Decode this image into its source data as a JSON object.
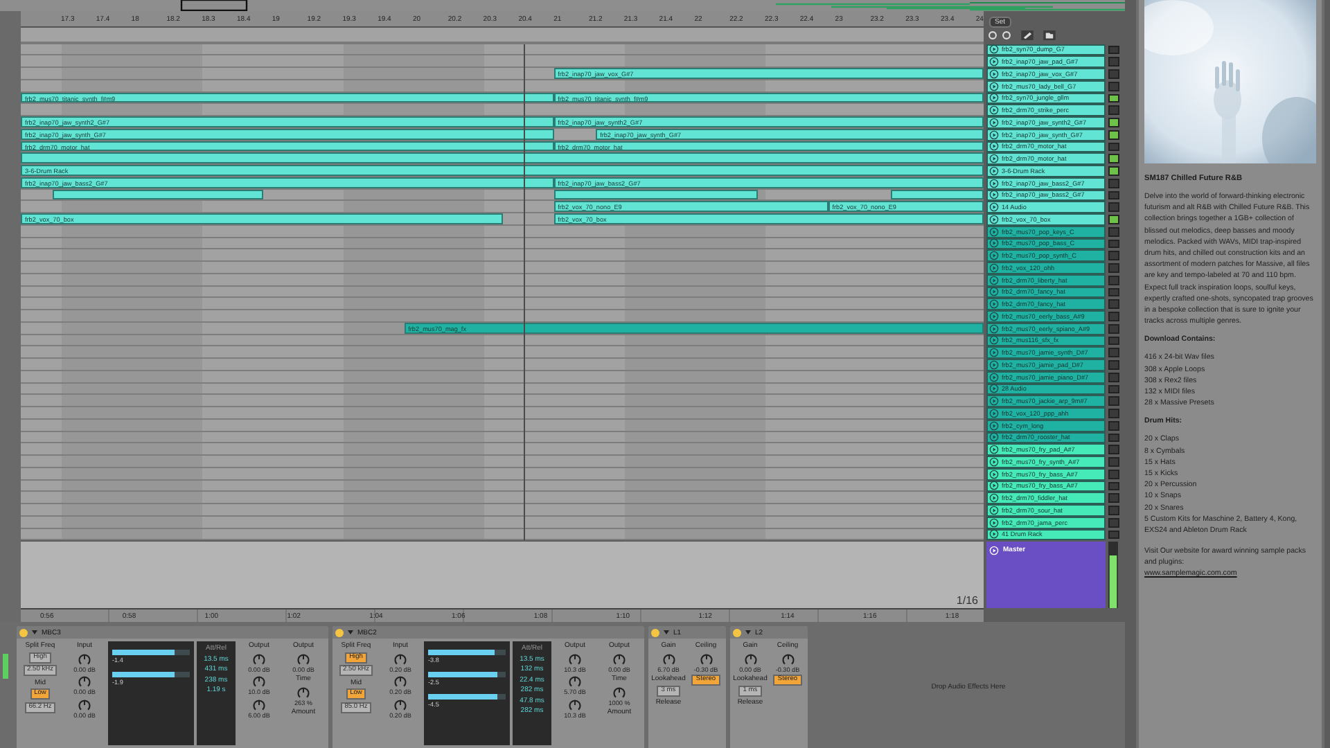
{
  "ruler": {
    "ticks": [
      "17.3",
      "17.4",
      "18",
      "18.2",
      "18.3",
      "18.4",
      "19",
      "19.2",
      "19.3",
      "19.4",
      "20",
      "20.2",
      "20.3",
      "20.4",
      "21",
      "21.2",
      "21.3",
      "21.4",
      "22",
      "22.2",
      "22.3",
      "22.4",
      "23",
      "23.2",
      "23.3",
      "23.4",
      "24"
    ]
  },
  "set_button": "Set",
  "tracks": [
    {
      "name": "frb2_syn70_dump_G7",
      "color": "#62e4d4",
      "active": false
    },
    {
      "name": "frb2_inap70_jaw_pad_G#7",
      "color": "#62e4d4",
      "active": false
    },
    {
      "name": "frb2_inap70_jaw_vox_G#7",
      "color": "#62e4d4",
      "active": false,
      "clips": [
        {
          "kind": "tail",
          "label": "frb2_inap70_jaw_vox_G#7"
        }
      ]
    },
    {
      "name": "frb2_mus70_lady_bell_G7",
      "color": "#62e4d4",
      "active": false
    },
    {
      "name": "frb2_syn70_jungle_gllm",
      "color": "#62e4d4",
      "active": true,
      "clips": [
        {
          "kind": "lead",
          "label": "frb2_mus70_titanic_synth_f#m9"
        },
        {
          "kind": "tail",
          "label": "frb2_mus70_titanic_synth_f#m9"
        }
      ]
    },
    {
      "name": "frb2_drm70_strike_perc",
      "color": "#62e4d4",
      "active": false
    },
    {
      "name": "frb2_inap70_jaw_synth2_G#7",
      "color": "#62e4d4",
      "active": true,
      "clips": [
        {
          "kind": "lead",
          "label": "frb2_inap70_jaw_synth2_G#7"
        },
        {
          "kind": "tail",
          "label": "frb2_inap70_jaw_synth2_G#7"
        }
      ]
    },
    {
      "name": "frb2_inap70_jaw_synth_G#7",
      "color": "#62e4d4",
      "active": true,
      "clips": [
        {
          "kind": "lead",
          "label": "frb2_inap70_jaw_synth_G#7"
        },
        {
          "kind": "tail_late",
          "label": "frb2_inap70_jaw_synth_G#7"
        }
      ]
    },
    {
      "name": "frb2_drm70_motor_hat",
      "color": "#62e4d4",
      "active": false,
      "clips": [
        {
          "kind": "lead",
          "label": "frb2_drm70_motor_hat"
        },
        {
          "kind": "tail",
          "label": "frb2_drm70_motor_hat"
        }
      ]
    },
    {
      "name": "frb2_drm70_motor_hat",
      "color": "#62e4d4",
      "active": true,
      "clips": [
        {
          "kind": "full"
        }
      ]
    },
    {
      "name": "3-6-Drum Rack",
      "color": "#62e4d4",
      "active": true,
      "clips": [
        {
          "kind": "full",
          "label": "3-6-Drum Rack"
        }
      ]
    },
    {
      "name": "frb2_inap70_jaw_bass2_G#7",
      "color": "#62e4d4",
      "active": false,
      "clips": [
        {
          "kind": "lead",
          "label": "frb2_inap70_jaw_bass2_G#7"
        },
        {
          "kind": "tail",
          "label": "frb2_inap70_jaw_bass2_G#7"
        }
      ]
    },
    {
      "name": "frb2_inap70_jaw_bass2_G#7",
      "color": "#62e4d4",
      "active": false,
      "clips": [
        {
          "kind": "fragment_early"
        },
        {
          "kind": "fragment_mid"
        },
        {
          "kind": "fragment_late"
        }
      ]
    },
    {
      "name": "14 Audio",
      "color": "#62e4d4",
      "active": false,
      "clips": [
        {
          "kind": "phrase",
          "label": "frb2_vox_70_nono_E9"
        },
        {
          "kind": "phrase_end",
          "label": "frb2_vox_70_nono_E9"
        }
      ]
    },
    {
      "name": "frb2_vox_70_box",
      "color": "#62e4d4",
      "active": true,
      "clips": [
        {
          "kind": "lead_short",
          "label": "frb2_vox_70_box"
        },
        {
          "kind": "tail",
          "label": "frb2_vox_70_box"
        }
      ]
    },
    {
      "name": "frb2_mus70_pop_keys_C",
      "color": "#1fb2a2",
      "active": false
    },
    {
      "name": "frb2_mus70_pop_bass_C",
      "color": "#1fb2a2",
      "active": false
    },
    {
      "name": "frb2_mus70_pop_synth_C",
      "color": "#1fb2a2",
      "active": false
    },
    {
      "name": "frb2_vox_120_ohh",
      "color": "#1fb2a2",
      "active": false
    },
    {
      "name": "frb2_drm70_liberty_hat",
      "color": "#1fb2a2",
      "active": false
    },
    {
      "name": "frb2_drm70_fancy_hat",
      "color": "#1fb2a2",
      "active": false
    },
    {
      "name": "frb2_drm70_fancy_hat",
      "color": "#1fb2a2",
      "active": false
    },
    {
      "name": "frb2_mus70_eerly_bass_A#9",
      "color": "#1fb2a2",
      "active": false
    },
    {
      "name": "frb2_mus70_eerly_spiano_A#9",
      "color": "#1fb2a2",
      "active": false,
      "clips": [
        {
          "kind": "late_entry",
          "label": "frb2_mus70_mag_fx"
        }
      ]
    },
    {
      "name": "frb2_mus116_sfx_fx",
      "color": "#1fb2a2",
      "active": false
    },
    {
      "name": "frb2_mus70_jamie_synth_D#7",
      "color": "#1fb2a2",
      "active": false
    },
    {
      "name": "frb2_mus70_jamie_pad_D#7",
      "color": "#1fb2a2",
      "active": false
    },
    {
      "name": "frb2_mus70_jamie_piano_D#7",
      "color": "#1fb2a2",
      "active": false
    },
    {
      "name": "28 Audio",
      "color": "#1fb2a2",
      "active": false
    },
    {
      "name": "frb2_mus70_jackie_arp_9m#7",
      "color": "#1fb2a2",
      "active": false
    },
    {
      "name": "frb2_vox_120_ppp_ahh",
      "color": "#1fb2a2",
      "active": false
    },
    {
      "name": "frb2_cym_long",
      "color": "#1fb2a2",
      "active": false
    },
    {
      "name": "frb2_drm70_rooster_hat",
      "color": "#1fb2a2",
      "active": false
    },
    {
      "name": "frb2_mus70_fry_pad_A#7",
      "color": "#46eab8",
      "active": false
    },
    {
      "name": "frb2_mus70_fry_synth_A#7",
      "color": "#46eab8",
      "active": false
    },
    {
      "name": "frb2_mus70_fry_bass_A#7",
      "color": "#46eab8",
      "active": false
    },
    {
      "name": "frb2_mus70_fry_bass_A#7",
      "color": "#46eab8",
      "active": false
    },
    {
      "name": "frb2_drm70_fiddler_hat",
      "color": "#46eab8",
      "active": false
    },
    {
      "name": "frb2_drm70_sour_hat",
      "color": "#46eab8",
      "active": false
    },
    {
      "name": "frb2_drm70_jama_perc",
      "color": "#46eab8",
      "active": false
    },
    {
      "name": "41 Drum Rack",
      "color": "#46eab8",
      "active": false
    }
  ],
  "master": {
    "name": "Master",
    "color": "#6a4fc4"
  },
  "grid_label": "1/16",
  "time_ruler": {
    "ticks": [
      "0:56",
      "0:58",
      "1:00",
      "1:02",
      "1:04",
      "1:06",
      "1:08",
      "1:10",
      "1:12",
      "1:14",
      "1:16",
      "1:18"
    ]
  },
  "devices": [
    {
      "name": "MBC3",
      "kind": "multiband",
      "on": true,
      "columns": [
        {
          "kind": "plain",
          "items": [
            {
              "kind": "label",
              "text": "Split Freq"
            },
            {
              "kind": "button",
              "text": "High",
              "on": false
            },
            {
              "kind": "button",
              "text": "2.50 kHz",
              "on": false
            },
            {
              "kind": "label",
              "text": "Mid"
            },
            {
              "kind": "button",
              "text": "Low",
              "on": true
            },
            {
              "kind": "button",
              "text": "66.2 Hz",
              "on": false
            }
          ]
        },
        {
          "kind": "plain",
          "items": [
            {
              "kind": "label",
              "text": "Input"
            },
            {
              "kind": "knob",
              "text": "0.00 dB"
            },
            {
              "kind": "knob",
              "text": "0.00 dB"
            },
            {
              "kind": "knob",
              "text": "0.00 dB"
            }
          ]
        },
        {
          "kind": "display",
          "items": [
            {
              "kind": "meter",
              "text": "-1.4",
              "level": 0.8
            },
            {
              "kind": "meter",
              "text": "-1.9",
              "level": 0.8
            }
          ]
        },
        {
          "kind": "readouts",
          "items": [
            {
              "kind": "label",
              "text": "Att/Rel"
            },
            {
              "kind": "readout",
              "text": "13.5 ms"
            },
            {
              "kind": "readout",
              "text": "431 ms"
            },
            {
              "kind": "readout",
              "text": "238 ms"
            },
            {
              "kind": "readout",
              "text": "1.19 s"
            }
          ]
        },
        {
          "kind": "plain",
          "items": [
            {
              "kind": "label",
              "text": "Output"
            },
            {
              "kind": "knob",
              "text": "0.00 dB"
            },
            {
              "kind": "knob",
              "text": "10.0 dB"
            },
            {
              "kind": "knob",
              "text": "6.00 dB"
            }
          ]
        },
        {
          "kind": "plain",
          "items": [
            {
              "kind": "label",
              "text": "Output"
            },
            {
              "kind": "knob",
              "text": "0.00 dB"
            },
            {
              "kind": "label",
              "text": "Time"
            },
            {
              "kind": "knob",
              "text": "263 %"
            },
            {
              "kind": "label",
              "text": "Amount"
            }
          ]
        }
      ]
    },
    {
      "name": "MBC2",
      "kind": "multiband",
      "on": true,
      "columns": [
        {
          "kind": "plain",
          "items": [
            {
              "kind": "label",
              "text": "Split Freq"
            },
            {
              "kind": "button",
              "text": "High",
              "on": true
            },
            {
              "kind": "button",
              "text": "2.50 kHz",
              "on": false
            },
            {
              "kind": "label",
              "text": "Mid"
            },
            {
              "kind": "button",
              "text": "Low",
              "on": true
            },
            {
              "kind": "button",
              "text": "85.0 Hz",
              "on": false
            }
          ]
        },
        {
          "kind": "plain",
          "items": [
            {
              "kind": "label",
              "text": "Input"
            },
            {
              "kind": "knob",
              "text": "0.20 dB"
            },
            {
              "kind": "knob",
              "text": "0.20 dB"
            },
            {
              "kind": "knob",
              "text": "0.20 dB"
            }
          ]
        },
        {
          "kind": "display",
          "items": [
            {
              "kind": "meter",
              "text": "-3.8",
              "level": 0.85
            },
            {
              "kind": "meter",
              "text": "-2.5",
              "level": 0.9
            },
            {
              "kind": "meter",
              "text": "-4.5",
              "level": 0.9
            }
          ]
        },
        {
          "kind": "readouts",
          "items": [
            {
              "kind": "label",
              "text": "Att/Rel"
            },
            {
              "kind": "readout",
              "text": "13.5 ms"
            },
            {
              "kind": "readout",
              "text": "132 ms"
            },
            {
              "kind": "readout",
              "text": "22.4 ms"
            },
            {
              "kind": "readout",
              "text": "282 ms"
            },
            {
              "kind": "readout",
              "text": "47.8 ms"
            },
            {
              "kind": "readout",
              "text": "282 ms"
            }
          ]
        },
        {
          "kind": "plain",
          "items": [
            {
              "kind": "label",
              "text": "Output"
            },
            {
              "kind": "knob",
              "text": "10.3 dB"
            },
            {
              "kind": "knob",
              "text": "5.70 dB"
            },
            {
              "kind": "knob",
              "text": "10.3 dB"
            }
          ]
        },
        {
          "kind": "plain",
          "items": [
            {
              "kind": "label",
              "text": "Output"
            },
            {
              "kind": "knob",
              "text": "0.00 dB"
            },
            {
              "kind": "label",
              "text": "Time"
            },
            {
              "kind": "knob",
              "text": "1000 %"
            },
            {
              "kind": "label",
              "text": "Amount"
            }
          ]
        }
      ]
    },
    {
      "name": "L1",
      "kind": "limiter",
      "on": true,
      "columns": [
        {
          "kind": "plain",
          "items": [
            {
              "kind": "label",
              "text": "Gain"
            },
            {
              "kind": "knob",
              "text": "6.70 dB"
            },
            {
              "kind": "label",
              "text": "Lookahead"
            },
            {
              "kind": "button",
              "text": "3 ms",
              "on": false
            },
            {
              "kind": "label",
              "text": "Release"
            }
          ]
        },
        {
          "kind": "plain",
          "items": [
            {
              "kind": "label",
              "text": "Ceiling"
            },
            {
              "kind": "knob",
              "text": "-0.30 dB"
            },
            {
              "kind": "button",
              "text": "Stereo",
              "on": true
            }
          ]
        }
      ]
    },
    {
      "name": "L2",
      "kind": "limiter",
      "on": true,
      "columns": [
        {
          "kind": "plain",
          "items": [
            {
              "kind": "label",
              "text": "Gain"
            },
            {
              "kind": "knob",
              "text": "0.00 dB"
            },
            {
              "kind": "label",
              "text": "Lookahead"
            },
            {
              "kind": "button",
              "text": "1 ms",
              "on": false
            },
            {
              "kind": "label",
              "text": "Release"
            }
          ]
        },
        {
          "kind": "plain",
          "items": [
            {
              "kind": "label",
              "text": "Ceiling"
            },
            {
              "kind": "knob",
              "text": "-0.30 dB"
            },
            {
              "kind": "button",
              "text": "Stereo",
              "on": true
            }
          ]
        }
      ]
    }
  ],
  "drop_hint": "Drop Audio Effects Here",
  "info_panel": {
    "title": "SM187 Chilled Future R&B",
    "description": "Delve into the world of forward-thinking electronic futurism and alt R&B with Chilled Future R&B. This collection brings together a 1GB+ collection of blissed out melodics, deep basses and moody melodics. Packed with WAVs, MIDI trap-inspired drum hits, and chilled out construction kits and an assortment of modern patches for Massive, all files are key and tempo-labeled at 70 and 110 bpm. Expect full track inspiration loops, soulful keys, expertly crafted one-shots, syncopated trap grooves in a bespoke collection that is sure to ignite your tracks across multiple genres.",
    "sections": [
      {
        "heading": "Download Contains:",
        "items": [
          "416 x 24-bit Wav files",
          "308 x Apple Loops",
          "308 x Rex2 files",
          "132 x MIDI files",
          "28 x Massive Presets"
        ]
      },
      {
        "heading": "Drum Hits:",
        "items": [
          "20 x Claps",
          "8 x Cymbals",
          "15 x Hats",
          "15 x Kicks",
          "20 x Percussion",
          "10 x Snaps",
          "20 x Snares",
          "5 Custom Kits for Maschine 2, Battery 4, Kong, EXS24 and Ableton Drum Rack"
        ]
      }
    ],
    "note": "Visit Our website for award winning sample packs and plugins:",
    "link": "www.samplemagic.com.com"
  }
}
